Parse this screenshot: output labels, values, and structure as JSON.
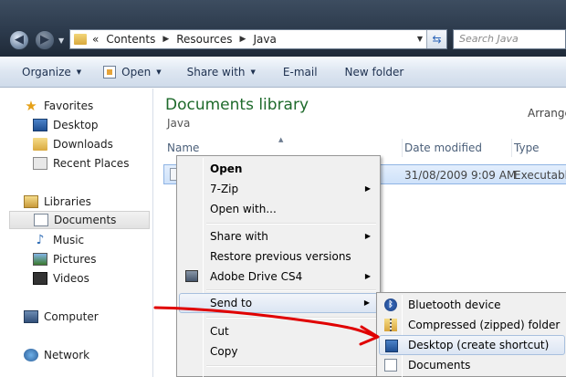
{
  "address_bar": {
    "overflow": "«",
    "segments": [
      "Contents",
      "Resources",
      "Java"
    ],
    "search_placeholder": "Search Java"
  },
  "toolbar": {
    "organize": "Organize",
    "open": "Open",
    "share_with": "Share with",
    "email": "E-mail",
    "new_folder": "New folder"
  },
  "nav": {
    "favorites": "Favorites",
    "desktop": "Desktop",
    "downloads": "Downloads",
    "recent_places": "Recent Places",
    "libraries": "Libraries",
    "documents": "Documents",
    "music": "Music",
    "pictures": "Pictures",
    "videos": "Videos",
    "computer": "Computer",
    "network": "Network"
  },
  "content": {
    "title": "Documents library",
    "subtitle": "Java",
    "arrange": "Arrange",
    "columns": {
      "name": "Name",
      "date_modified": "Date modified",
      "type": "Type"
    },
    "file": {
      "date_modified": "31/08/2009 9:09 AM",
      "type": "Executable"
    }
  },
  "context_menu": {
    "open": "Open",
    "seven_zip": "7-Zip",
    "open_with": "Open with...",
    "share_with": "Share with",
    "restore_previous": "Restore previous versions",
    "adobe_drive": "Adobe Drive CS4",
    "send_to": "Send to",
    "cut": "Cut",
    "copy": "Copy"
  },
  "send_to_menu": {
    "bluetooth": "Bluetooth device",
    "compressed": "Compressed (zipped) folder",
    "desktop_shortcut": "Desktop (create shortcut)",
    "documents": "Documents"
  },
  "colors": {
    "annotation": "#e00000",
    "library_title": "#1e6a2b"
  }
}
